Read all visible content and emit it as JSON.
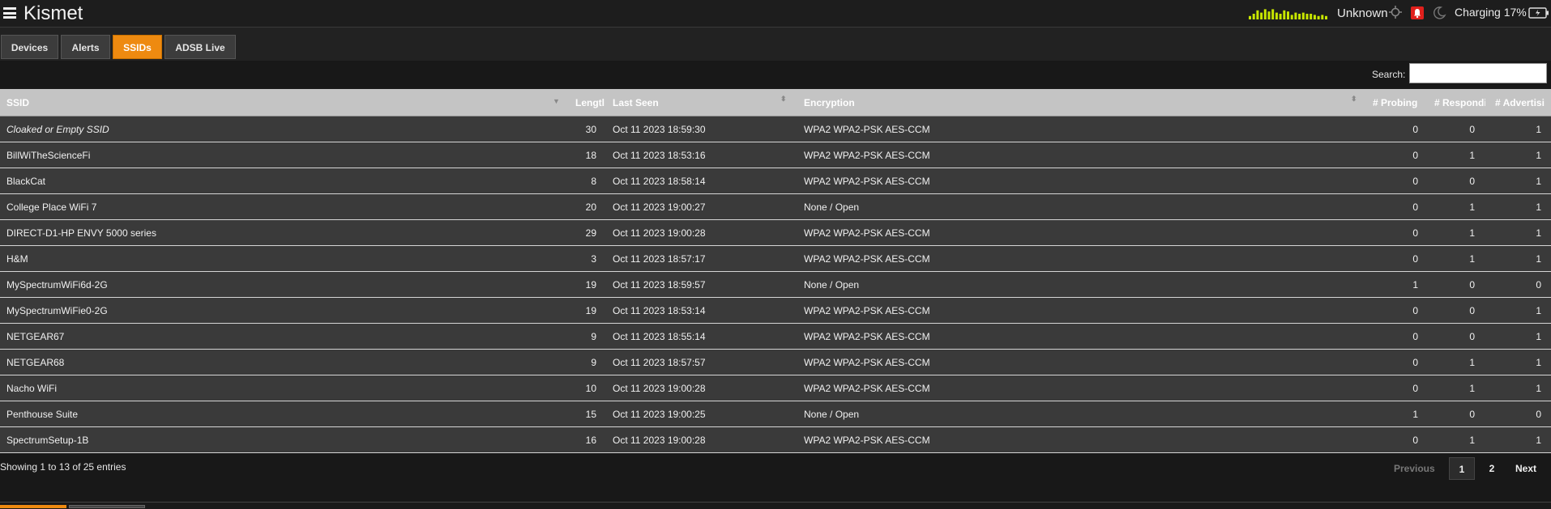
{
  "header": {
    "title": "Kismet",
    "gps_status": "Unknown",
    "battery": "Charging 17%",
    "signal_levels": [
      3,
      5,
      8,
      6,
      9,
      7,
      9,
      6,
      5,
      8,
      7,
      4,
      6,
      5,
      6,
      5,
      5,
      4,
      3,
      4,
      3
    ],
    "accent": "#ee8a10",
    "alert_color": "#e0201c",
    "signal_color": "#c8e600"
  },
  "tabs": [
    {
      "label": "Devices",
      "active": false
    },
    {
      "label": "Alerts",
      "active": false
    },
    {
      "label": "SSIDs",
      "active": true
    },
    {
      "label": "ADSB Live",
      "active": false
    }
  ],
  "search": {
    "label": "Search:",
    "value": ""
  },
  "table": {
    "columns": [
      "SSID",
      "Lengtl",
      "Last Seen",
      "Encryption",
      "# Probing",
      "# Respondi",
      "# Advertisi"
    ],
    "rows": [
      {
        "ssid": "Cloaked or Empty SSID",
        "length": "30",
        "last_seen": "Oct 11 2023 18:59:30",
        "encryption": "WPA2 WPA2-PSK AES-CCM",
        "probing": "0",
        "responding": "0",
        "advertising": "1"
      },
      {
        "ssid": "BillWiTheScienceFi",
        "length": "18",
        "last_seen": "Oct 11 2023 18:53:16",
        "encryption": "WPA2 WPA2-PSK AES-CCM",
        "probing": "0",
        "responding": "1",
        "advertising": "1"
      },
      {
        "ssid": "BlackCat",
        "length": "8",
        "last_seen": "Oct 11 2023 18:58:14",
        "encryption": "WPA2 WPA2-PSK AES-CCM",
        "probing": "0",
        "responding": "0",
        "advertising": "1"
      },
      {
        "ssid": "College Place WiFi 7",
        "length": "20",
        "last_seen": "Oct 11 2023 19:00:27",
        "encryption": "None / Open",
        "probing": "0",
        "responding": "1",
        "advertising": "1"
      },
      {
        "ssid": "DIRECT-D1-HP ENVY 5000 series",
        "length": "29",
        "last_seen": "Oct 11 2023 19:00:28",
        "encryption": "WPA2 WPA2-PSK AES-CCM",
        "probing": "0",
        "responding": "1",
        "advertising": "1"
      },
      {
        "ssid": "H&M",
        "length": "3",
        "last_seen": "Oct 11 2023 18:57:17",
        "encryption": "WPA2 WPA2-PSK AES-CCM",
        "probing": "0",
        "responding": "1",
        "advertising": "1"
      },
      {
        "ssid": "MySpectrumWiFi6d-2G",
        "length": "19",
        "last_seen": "Oct 11 2023 18:59:57",
        "encryption": "None / Open",
        "probing": "1",
        "responding": "0",
        "advertising": "0"
      },
      {
        "ssid": "MySpectrumWiFie0-2G",
        "length": "19",
        "last_seen": "Oct 11 2023 18:53:14",
        "encryption": "WPA2 WPA2-PSK AES-CCM",
        "probing": "0",
        "responding": "0",
        "advertising": "1"
      },
      {
        "ssid": "NETGEAR67",
        "length": "9",
        "last_seen": "Oct 11 2023 18:55:14",
        "encryption": "WPA2 WPA2-PSK AES-CCM",
        "probing": "0",
        "responding": "0",
        "advertising": "1"
      },
      {
        "ssid": "NETGEAR68",
        "length": "9",
        "last_seen": "Oct 11 2023 18:57:57",
        "encryption": "WPA2 WPA2-PSK AES-CCM",
        "probing": "0",
        "responding": "1",
        "advertising": "1"
      },
      {
        "ssid": "Nacho WiFi",
        "length": "10",
        "last_seen": "Oct 11 2023 19:00:28",
        "encryption": "WPA2 WPA2-PSK AES-CCM",
        "probing": "0",
        "responding": "1",
        "advertising": "1"
      },
      {
        "ssid": "Penthouse Suite",
        "length": "15",
        "last_seen": "Oct 11 2023 19:00:25",
        "encryption": "None / Open",
        "probing": "1",
        "responding": "0",
        "advertising": "0"
      },
      {
        "ssid": "SpectrumSetup-1B",
        "length": "16",
        "last_seen": "Oct 11 2023 19:00:28",
        "encryption": "WPA2 WPA2-PSK AES-CCM",
        "probing": "0",
        "responding": "1",
        "advertising": "1"
      }
    ]
  },
  "footer": {
    "info": "Showing 1 to 13 of 25 entries",
    "previous": "Previous",
    "pages": [
      "1",
      "2"
    ],
    "next": "Next"
  }
}
